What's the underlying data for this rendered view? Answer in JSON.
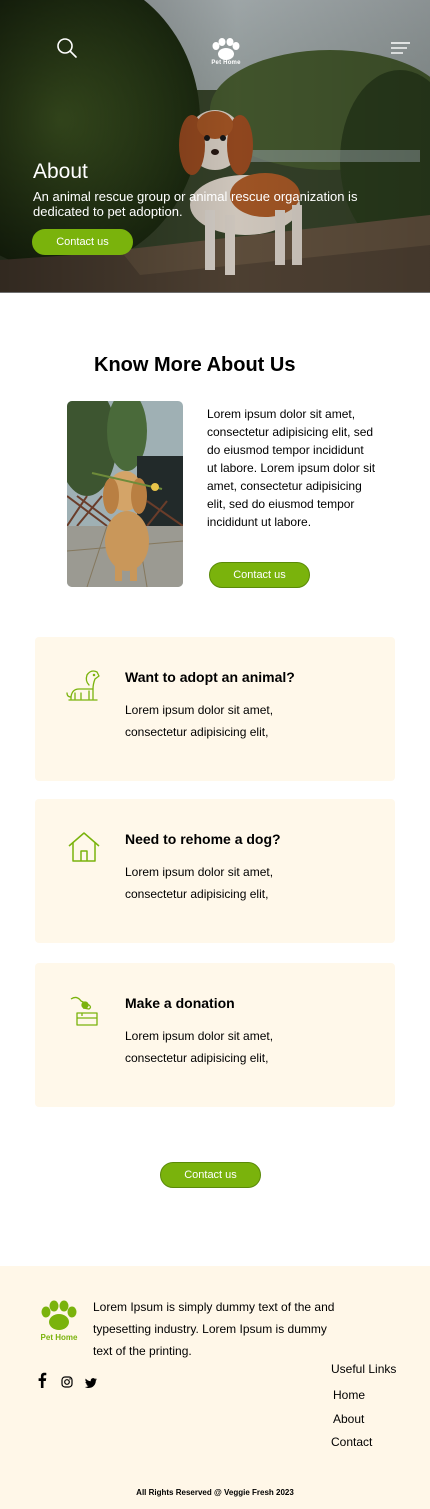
{
  "header": {
    "logo_text": "Pet Home"
  },
  "hero": {
    "title": "About",
    "description": "An animal rescue group or animal rescue organization is dedicated to pet adoption.",
    "button_label": "Contact us"
  },
  "about": {
    "title": "Know More About Us",
    "text": "Lorem ipsum dolor sit amet, consectetur adipisicing elit, sed do eiusmod tempor incididunt ut labore. Lorem ipsum dolor sit amet, consectetur adipisicing elit, sed do eiusmod tempor incididunt ut labore.",
    "button_label": "Contact us"
  },
  "cards": [
    {
      "icon": "dog-icon",
      "title": "Want to adopt an animal?",
      "text": "Lorem ipsum dolor sit amet, consectetur adipisicing elit,"
    },
    {
      "icon": "house-icon",
      "title": "Need to rehome a dog?",
      "text": "Lorem ipsum dolor sit amet, consectetur adipisicing elit,"
    },
    {
      "icon": "donation-icon",
      "title": "Make a donation",
      "text": "Lorem ipsum dolor sit amet, consectetur adipisicing elit,"
    }
  ],
  "cta": {
    "button_label": "Contact us"
  },
  "footer": {
    "logo_text": "Pet Home",
    "about_text": "Lorem Ipsum is simply dummy text of the and typesetting industry. Lorem Ipsum is dummy text of the printing.",
    "social": [
      "facebook-icon",
      "instagram-icon",
      "twitter-icon"
    ],
    "links_title": "Useful Links",
    "links": [
      "Home",
      "About",
      "Contact"
    ],
    "copyright": "All Rights Reserved @ Veggie Fresh 2023"
  },
  "colors": {
    "accent": "#7ab30c",
    "card_bg": "#fff8ea",
    "footer_bg": "#fff7e8"
  }
}
